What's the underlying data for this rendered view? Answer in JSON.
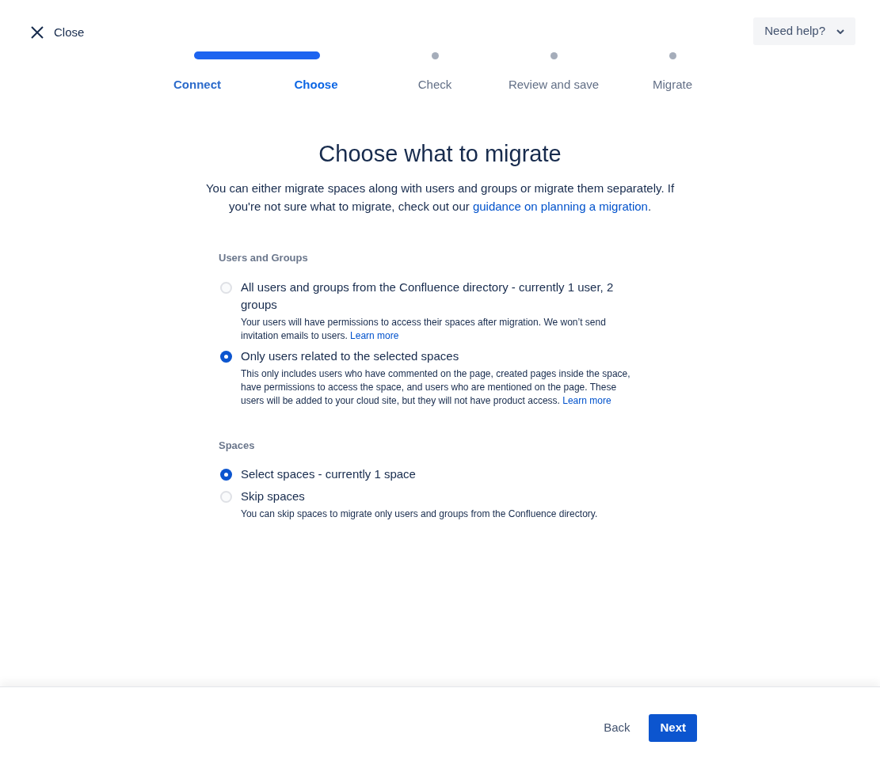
{
  "close": {
    "label": "Close"
  },
  "help": {
    "label": "Need help?"
  },
  "steps": [
    {
      "label": "Connect",
      "completed": true,
      "current": false
    },
    {
      "label": "Choose",
      "completed": false,
      "current": true
    },
    {
      "label": "Check",
      "completed": false,
      "current": false
    },
    {
      "label": "Review and save",
      "completed": false,
      "current": false
    },
    {
      "label": "Migrate",
      "completed": false,
      "current": false
    }
  ],
  "title": "Choose what to migrate",
  "intro": {
    "text": "You can either migrate spaces along with users and groups or migrate them separately. If you're not sure what to migrate, check out our",
    "link": "guidance on planning a migration",
    "end": "."
  },
  "sections": [
    {
      "heading": "Users and Groups",
      "options": [
        {
          "label": "All users and groups from the Confluence directory - currently 1 user, 2 groups",
          "selected": false,
          "description": "Your users will have permissions to access their spaces after migration. We won’t send invitation emails to users.",
          "link": "Learn more"
        },
        {
          "label": "Only users related to the selected spaces",
          "selected": true,
          "description": "This only includes users who have commented on the page, created pages inside the space, have permissions to access the space, and users who are mentioned on the page. These users will be added to your cloud site, but they will not have product access.",
          "link": "Learn more"
        }
      ]
    },
    {
      "heading": "Spaces",
      "options": [
        {
          "label": "Select spaces - currently 1 space",
          "selected": true
        },
        {
          "label": "Skip spaces",
          "selected": false,
          "description": "You can skip spaces to migrate only users and groups from the Confluence directory."
        }
      ]
    }
  ],
  "footer": {
    "back": "Back",
    "next": "Next"
  }
}
